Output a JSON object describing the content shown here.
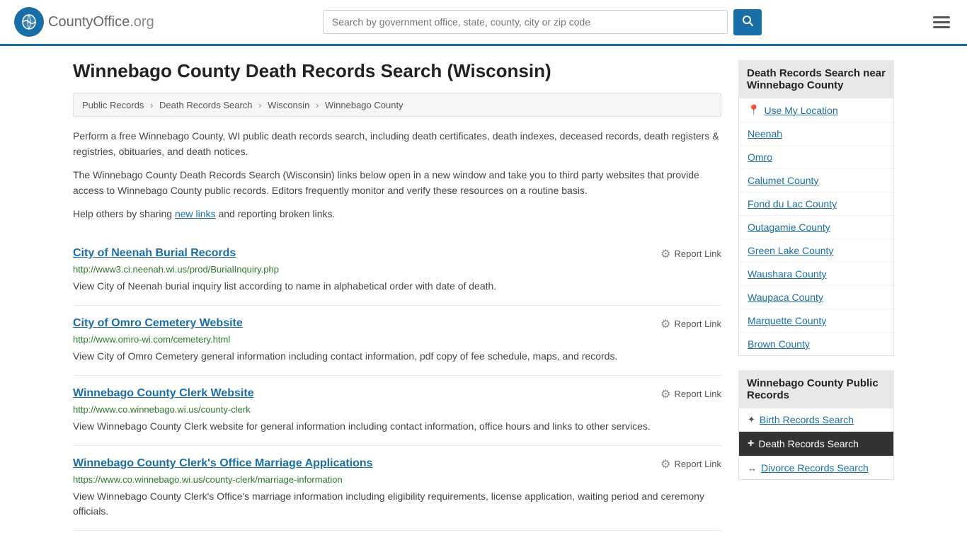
{
  "header": {
    "logo_text": "CountyOffice",
    "logo_suffix": ".org",
    "search_placeholder": "Search by government office, state, county, city or zip code",
    "search_btn_label": "🔍"
  },
  "page": {
    "title": "Winnebago County Death Records Search (Wisconsin)"
  },
  "breadcrumb": {
    "items": [
      "Public Records",
      "Death Records Search",
      "Wisconsin",
      "Winnebago County"
    ]
  },
  "description": {
    "para1": "Perform a free Winnebago County, WI public death records search, including death certificates, death indexes, deceased records, death registers & registries, obituaries, and death notices.",
    "para2": "The Winnebago County Death Records Search (Wisconsin) links below open in a new window and take you to third party websites that provide access to Winnebago County public records. Editors frequently monitor and verify these resources on a routine basis.",
    "para3_prefix": "Help others by sharing ",
    "para3_link": "new links",
    "para3_suffix": " and reporting broken links."
  },
  "records": [
    {
      "title": "City of Neenah Burial Records",
      "url": "http://www3.ci.neenah.wi.us/prod/BurialInquiry.php",
      "desc": "View City of Neenah burial inquiry list according to name in alphabetical order with date of death.",
      "report": "Report Link"
    },
    {
      "title": "City of Omro Cemetery Website",
      "url": "http://www.omro-wi.com/cemetery.html",
      "desc": "View City of Omro Cemetery general information including contact information, pdf copy of fee schedule, maps, and records.",
      "report": "Report Link"
    },
    {
      "title": "Winnebago County Clerk Website",
      "url": "http://www.co.winnebago.wi.us/county-clerk",
      "desc": "View Winnebago County Clerk website for general information including contact information, office hours and links to other services.",
      "report": "Report Link"
    },
    {
      "title": "Winnebago County Clerk's Office Marriage Applications",
      "url": "https://www.co.winnebago.wi.us/county-clerk/marriage-information",
      "desc": "View Winnebago County Clerk's Office's marriage information including eligibility requirements, license application, waiting period and ceremony officials.",
      "report": "Report Link"
    }
  ],
  "sidebar": {
    "nearby_header": "Death Records Search near Winnebago County",
    "location_label": "Use My Location",
    "nearby_links": [
      "Neenah",
      "Omro",
      "Calumet County",
      "Fond du Lac County",
      "Outagamie County",
      "Green Lake County",
      "Waushara County",
      "Waupaca County",
      "Marquette County",
      "Brown County"
    ],
    "public_records_header": "Winnebago County Public Records",
    "public_records_items": [
      {
        "label": "Birth Records Search",
        "active": false
      },
      {
        "label": "Death Records Search",
        "active": true
      },
      {
        "label": "Divorce Records Search",
        "active": false
      }
    ]
  }
}
